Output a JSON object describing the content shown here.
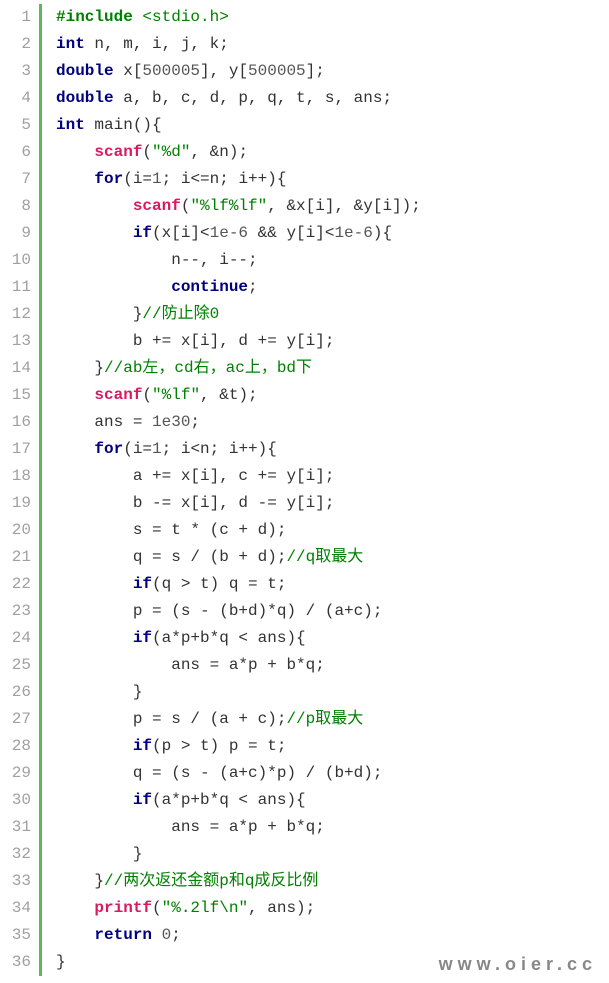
{
  "watermark": "www.oier.cc",
  "lines": [
    {
      "num": "1",
      "indent": 0,
      "tokens": [
        {
          "cls": "tok-dir",
          "t": "#include"
        },
        {
          "cls": "tok-inc-target",
          "t": " <stdio.h>"
        }
      ]
    },
    {
      "num": "2",
      "indent": 0,
      "tokens": [
        {
          "cls": "tok-kw",
          "t": "int"
        },
        {
          "cls": "tok-plain",
          "t": " n, m, i, j, k;"
        }
      ]
    },
    {
      "num": "3",
      "indent": 0,
      "tokens": [
        {
          "cls": "tok-kw",
          "t": "double"
        },
        {
          "cls": "tok-plain",
          "t": " x["
        },
        {
          "cls": "tok-num",
          "t": "500005"
        },
        {
          "cls": "tok-plain",
          "t": "], y["
        },
        {
          "cls": "tok-num",
          "t": "500005"
        },
        {
          "cls": "tok-plain",
          "t": "];"
        }
      ]
    },
    {
      "num": "4",
      "indent": 0,
      "tokens": [
        {
          "cls": "tok-kw",
          "t": "double"
        },
        {
          "cls": "tok-plain",
          "t": " a, b, c, d, p, q, t, s, ans;"
        }
      ]
    },
    {
      "num": "5",
      "indent": 0,
      "tokens": [
        {
          "cls": "tok-kw",
          "t": "int"
        },
        {
          "cls": "tok-plain",
          "t": " main(){"
        }
      ]
    },
    {
      "num": "6",
      "indent": 1,
      "tokens": [
        {
          "cls": "tok-fn",
          "t": "scanf"
        },
        {
          "cls": "tok-plain",
          "t": "("
        },
        {
          "cls": "tok-str",
          "t": "\"%d\""
        },
        {
          "cls": "tok-plain",
          "t": ", &n);"
        }
      ]
    },
    {
      "num": "7",
      "indent": 1,
      "tokens": [
        {
          "cls": "tok-kw",
          "t": "for"
        },
        {
          "cls": "tok-plain",
          "t": "(i="
        },
        {
          "cls": "tok-num",
          "t": "1"
        },
        {
          "cls": "tok-plain",
          "t": "; i<=n; i++){"
        }
      ]
    },
    {
      "num": "8",
      "indent": 2,
      "tokens": [
        {
          "cls": "tok-fn",
          "t": "scanf"
        },
        {
          "cls": "tok-plain",
          "t": "("
        },
        {
          "cls": "tok-str",
          "t": "\"%lf%lf\""
        },
        {
          "cls": "tok-plain",
          "t": ", &x[i], &y[i]);"
        }
      ]
    },
    {
      "num": "9",
      "indent": 2,
      "tokens": [
        {
          "cls": "tok-kw",
          "t": "if"
        },
        {
          "cls": "tok-plain",
          "t": "(x[i]<"
        },
        {
          "cls": "tok-num",
          "t": "1e-6"
        },
        {
          "cls": "tok-plain",
          "t": " && y[i]<"
        },
        {
          "cls": "tok-num",
          "t": "1e-6"
        },
        {
          "cls": "tok-plain",
          "t": "){"
        }
      ]
    },
    {
      "num": "10",
      "indent": 3,
      "tokens": [
        {
          "cls": "tok-plain",
          "t": "n--, i--;"
        }
      ]
    },
    {
      "num": "11",
      "indent": 3,
      "tokens": [
        {
          "cls": "tok-kw",
          "t": "continue"
        },
        {
          "cls": "tok-plain",
          "t": ";"
        }
      ]
    },
    {
      "num": "12",
      "indent": 2,
      "tokens": [
        {
          "cls": "tok-plain",
          "t": "}"
        },
        {
          "cls": "tok-cmt",
          "t": "//防止除0"
        }
      ]
    },
    {
      "num": "13",
      "indent": 2,
      "tokens": [
        {
          "cls": "tok-plain",
          "t": "b += x[i], d += y[i];"
        }
      ]
    },
    {
      "num": "14",
      "indent": 1,
      "tokens": [
        {
          "cls": "tok-plain",
          "t": "}"
        },
        {
          "cls": "tok-cmt",
          "t": "//ab左，cd右，ac上，bd下"
        }
      ]
    },
    {
      "num": "15",
      "indent": 1,
      "tokens": [
        {
          "cls": "tok-fn",
          "t": "scanf"
        },
        {
          "cls": "tok-plain",
          "t": "("
        },
        {
          "cls": "tok-str",
          "t": "\"%lf\""
        },
        {
          "cls": "tok-plain",
          "t": ", &t);"
        }
      ]
    },
    {
      "num": "16",
      "indent": 1,
      "tokens": [
        {
          "cls": "tok-plain",
          "t": "ans = "
        },
        {
          "cls": "tok-num",
          "t": "1e30"
        },
        {
          "cls": "tok-plain",
          "t": ";"
        }
      ]
    },
    {
      "num": "17",
      "indent": 1,
      "tokens": [
        {
          "cls": "tok-kw",
          "t": "for"
        },
        {
          "cls": "tok-plain",
          "t": "(i="
        },
        {
          "cls": "tok-num",
          "t": "1"
        },
        {
          "cls": "tok-plain",
          "t": "; i<n; i++){"
        }
      ]
    },
    {
      "num": "18",
      "indent": 2,
      "tokens": [
        {
          "cls": "tok-plain",
          "t": "a += x[i], c += y[i];"
        }
      ]
    },
    {
      "num": "19",
      "indent": 2,
      "tokens": [
        {
          "cls": "tok-plain",
          "t": "b -= x[i], d -= y[i];"
        }
      ]
    },
    {
      "num": "20",
      "indent": 2,
      "tokens": [
        {
          "cls": "tok-plain",
          "t": "s = t * (c + d);"
        }
      ]
    },
    {
      "num": "21",
      "indent": 2,
      "tokens": [
        {
          "cls": "tok-plain",
          "t": "q = s / (b + d);"
        },
        {
          "cls": "tok-cmt",
          "t": "//q取最大"
        }
      ]
    },
    {
      "num": "22",
      "indent": 2,
      "tokens": [
        {
          "cls": "tok-kw",
          "t": "if"
        },
        {
          "cls": "tok-plain",
          "t": "(q > t) q = t;"
        }
      ]
    },
    {
      "num": "23",
      "indent": 2,
      "tokens": [
        {
          "cls": "tok-plain",
          "t": "p = (s - (b+d)*q) / (a+c);"
        }
      ]
    },
    {
      "num": "24",
      "indent": 2,
      "tokens": [
        {
          "cls": "tok-kw",
          "t": "if"
        },
        {
          "cls": "tok-plain",
          "t": "(a*p+b*q < ans){"
        }
      ]
    },
    {
      "num": "25",
      "indent": 3,
      "tokens": [
        {
          "cls": "tok-plain",
          "t": "ans = a*p + b*q;"
        }
      ]
    },
    {
      "num": "26",
      "indent": 2,
      "tokens": [
        {
          "cls": "tok-plain",
          "t": "}"
        }
      ]
    },
    {
      "num": "27",
      "indent": 2,
      "tokens": [
        {
          "cls": "tok-plain",
          "t": "p = s / (a + c);"
        },
        {
          "cls": "tok-cmt",
          "t": "//p取最大"
        }
      ]
    },
    {
      "num": "28",
      "indent": 2,
      "tokens": [
        {
          "cls": "tok-kw",
          "t": "if"
        },
        {
          "cls": "tok-plain",
          "t": "(p > t) p = t;"
        }
      ]
    },
    {
      "num": "29",
      "indent": 2,
      "tokens": [
        {
          "cls": "tok-plain",
          "t": "q = (s - (a+c)*p) / (b+d);"
        }
      ]
    },
    {
      "num": "30",
      "indent": 2,
      "tokens": [
        {
          "cls": "tok-kw",
          "t": "if"
        },
        {
          "cls": "tok-plain",
          "t": "(a*p+b*q < ans){"
        }
      ]
    },
    {
      "num": "31",
      "indent": 3,
      "tokens": [
        {
          "cls": "tok-plain",
          "t": "ans = a*p + b*q;"
        }
      ]
    },
    {
      "num": "32",
      "indent": 2,
      "tokens": [
        {
          "cls": "tok-plain",
          "t": "}"
        }
      ]
    },
    {
      "num": "33",
      "indent": 1,
      "tokens": [
        {
          "cls": "tok-plain",
          "t": "}"
        },
        {
          "cls": "tok-cmt",
          "t": "//两次返还金额p和q成反比例"
        }
      ]
    },
    {
      "num": "34",
      "indent": 1,
      "tokens": [
        {
          "cls": "tok-fn",
          "t": "printf"
        },
        {
          "cls": "tok-plain",
          "t": "("
        },
        {
          "cls": "tok-str",
          "t": "\"%.2lf\\n\""
        },
        {
          "cls": "tok-plain",
          "t": ", ans);"
        }
      ]
    },
    {
      "num": "35",
      "indent": 1,
      "tokens": [
        {
          "cls": "tok-kw",
          "t": "return"
        },
        {
          "cls": "tok-plain",
          "t": " "
        },
        {
          "cls": "tok-num",
          "t": "0"
        },
        {
          "cls": "tok-plain",
          "t": ";"
        }
      ]
    },
    {
      "num": "36",
      "indent": 0,
      "tokens": [
        {
          "cls": "tok-plain",
          "t": "}"
        }
      ]
    }
  ]
}
